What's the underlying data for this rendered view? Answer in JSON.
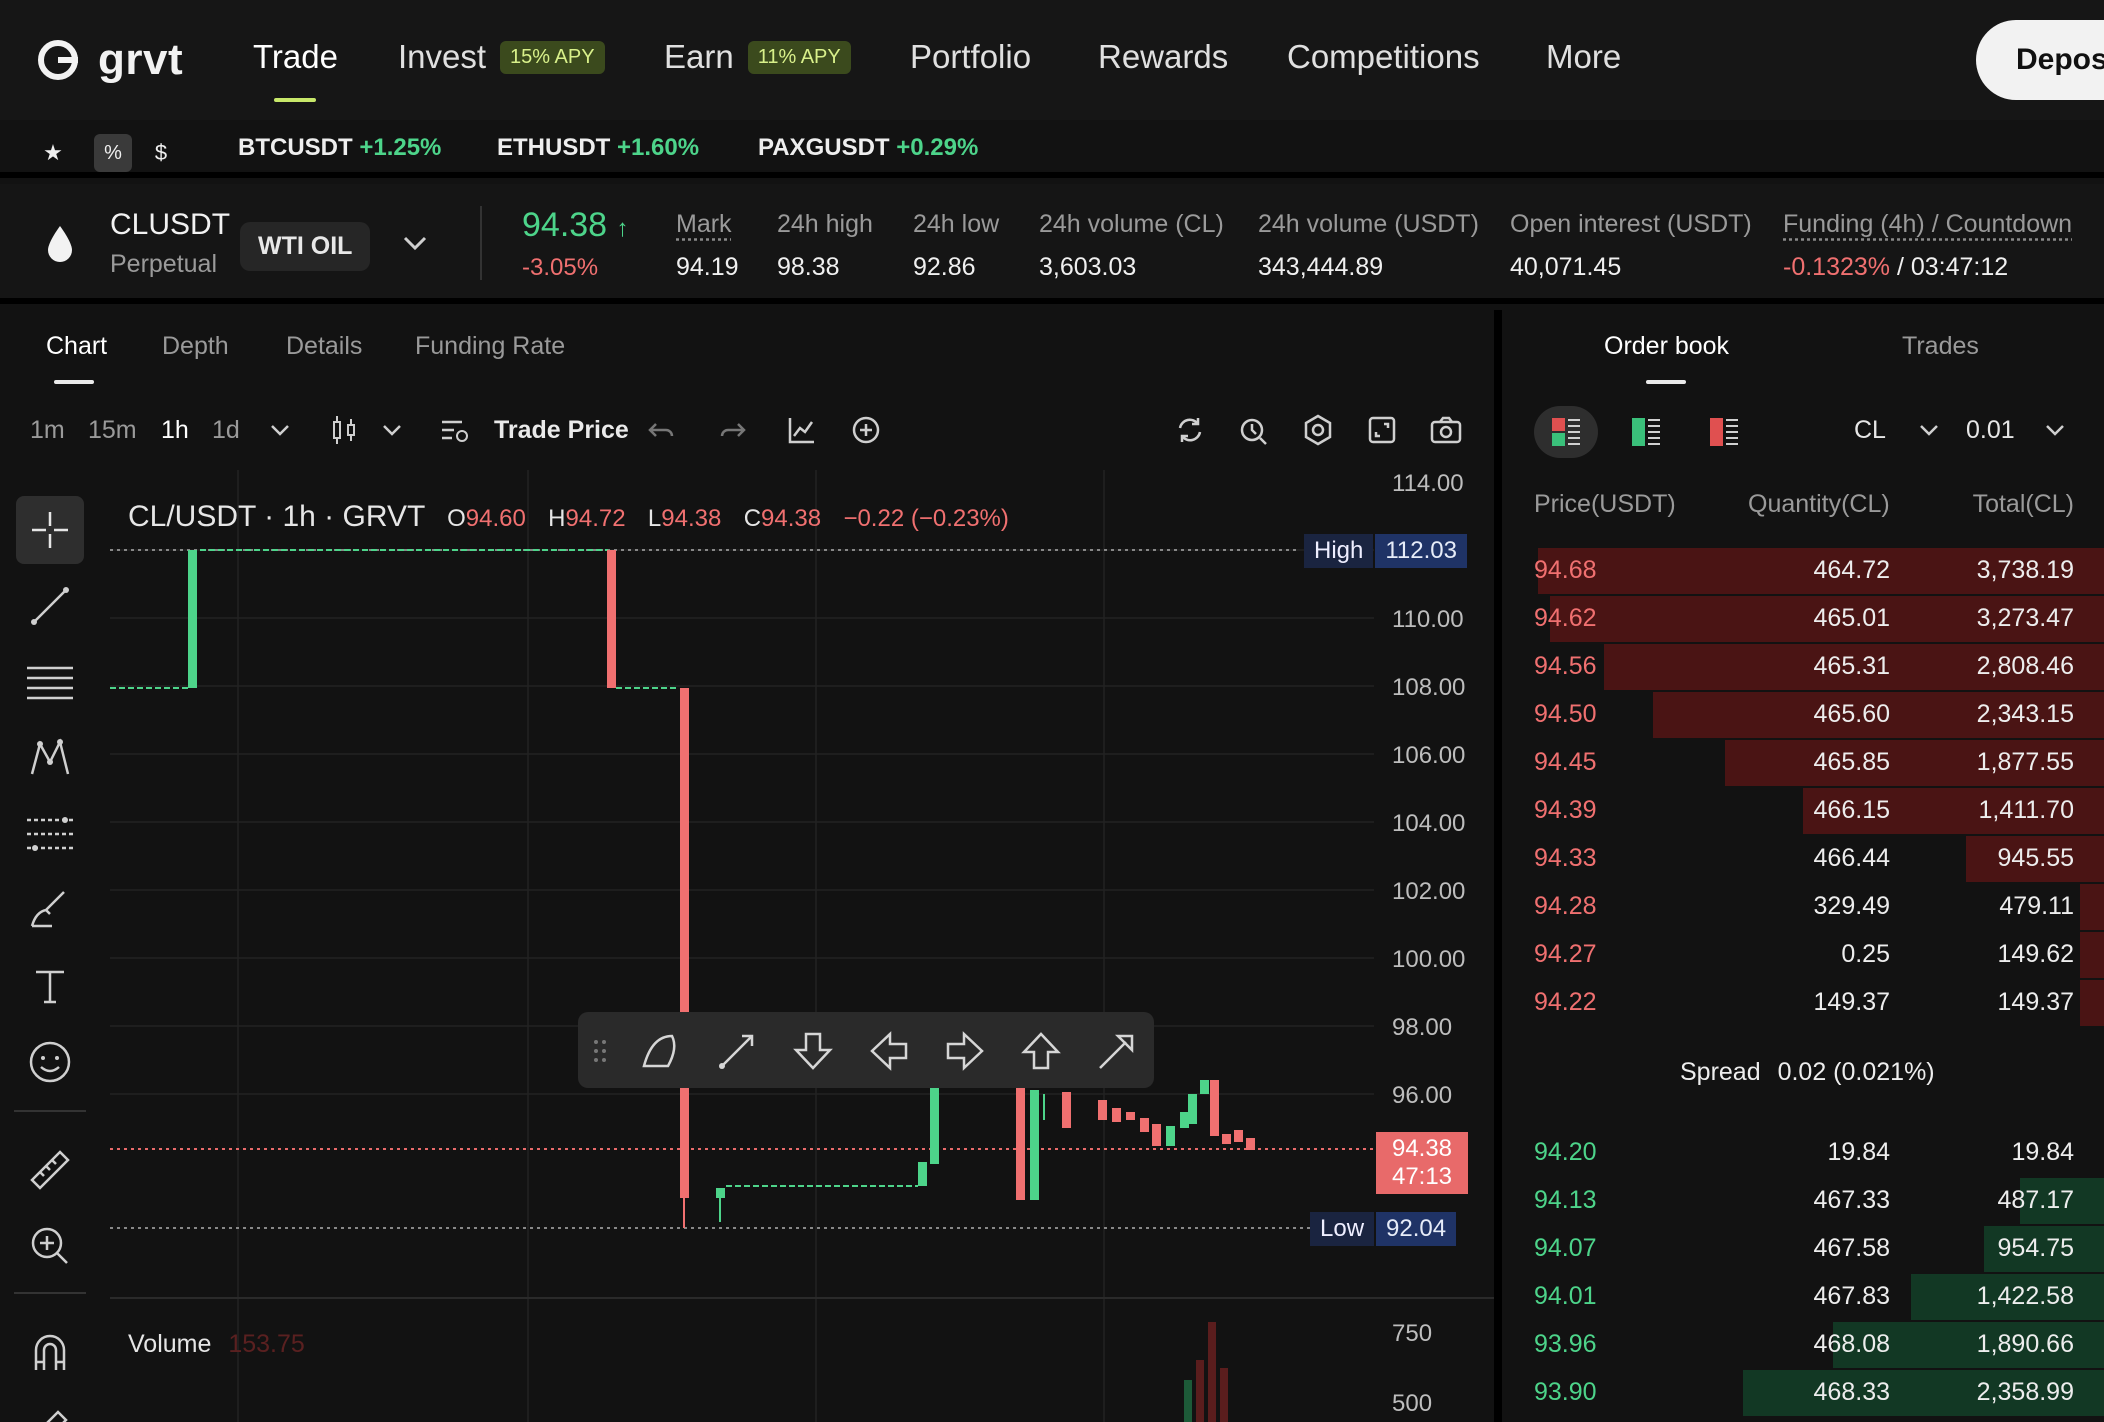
{
  "app": {
    "logo_text": "grvt",
    "nav": [
      {
        "label": "Trade"
      },
      {
        "label": "Invest",
        "badge": "15% APY"
      },
      {
        "label": "Earn",
        "badge": "11% APY"
      },
      {
        "label": "Portfolio"
      },
      {
        "label": "Rewards"
      },
      {
        "label": "Competitions"
      },
      {
        "label": "More"
      }
    ],
    "deposit_label": "Deposi"
  },
  "ticker": {
    "icons": {
      "star": "★",
      "percent": "%",
      "dollar": "$"
    },
    "items": [
      {
        "symbol": "BTCUSDT",
        "change": "+1.25%"
      },
      {
        "symbol": "ETHUSDT",
        "change": "+1.60%"
      },
      {
        "symbol": "PAXGUSDT",
        "change": "+0.29%"
      }
    ]
  },
  "instrument": {
    "symbol": "CLUSDT",
    "type": "Perpetual",
    "tag": "WTI OIL",
    "price": "94.38",
    "price_arrow": "↑",
    "change": "-3.05%",
    "stats": [
      {
        "label": "Mark",
        "value": "94.19"
      },
      {
        "label": "24h high",
        "value": "98.38"
      },
      {
        "label": "24h low",
        "value": "92.86"
      },
      {
        "label": "24h volume (CL)",
        "value": "3,603.03"
      },
      {
        "label": "24h volume (USDT)",
        "value": "343,444.89"
      },
      {
        "label": "Open interest (USDT)",
        "value": "40,071.45"
      }
    ],
    "funding": {
      "label": "Funding (4h) / Countdown",
      "rate": "-0.1323%",
      "sep": " / ",
      "countdown": "03:47:12"
    }
  },
  "chart_panel": {
    "tabs": [
      "Chart",
      "Depth",
      "Details",
      "Funding Rate"
    ],
    "timeframes": [
      "1m",
      "15m",
      "1h",
      "1d"
    ],
    "trade_price_label": "Trade Price",
    "legend": {
      "title": "CL/USDT · 1h · GRVT",
      "o_label": "O",
      "o": "94.60",
      "h_label": "H",
      "h": "94.72",
      "l_label": "L",
      "l": "94.38",
      "c_label": "C",
      "c": "94.38",
      "chg": "−0.22 (−0.23%)"
    },
    "axis": [
      "114.00",
      "110.00",
      "108.00",
      "106.00",
      "104.00",
      "102.00",
      "100.00",
      "98.00",
      "96.00"
    ],
    "high_tag": {
      "label": "High",
      "value": "112.03"
    },
    "low_tag": {
      "label": "Low",
      "value": "92.04"
    },
    "last_price_tag": {
      "price": "94.38",
      "countdown": "47:13"
    },
    "volume": {
      "label": "Volume",
      "value": "153.75",
      "axis": [
        "750",
        "500"
      ]
    },
    "colors": {
      "up": "#4dd48a",
      "down": "#f07070"
    }
  },
  "order_book": {
    "tabs": [
      "Order book",
      "Trades"
    ],
    "unit": "CL",
    "step": "0.01",
    "headers": {
      "price": "Price(USDT)",
      "qty": "Quantity(CL)",
      "total": "Total(CL)"
    },
    "asks": [
      {
        "price": "94.68",
        "qty": "464.72",
        "total": "3,738.19",
        "depth": 0.94
      },
      {
        "price": "94.62",
        "qty": "465.01",
        "total": "3,273.47",
        "depth": 0.92
      },
      {
        "price": "94.56",
        "qty": "465.31",
        "total": "2,808.46",
        "depth": 0.83
      },
      {
        "price": "94.50",
        "qty": "465.60",
        "total": "2,343.15",
        "depth": 0.75
      },
      {
        "price": "94.45",
        "qty": "465.85",
        "total": "1,877.55",
        "depth": 0.63
      },
      {
        "price": "94.39",
        "qty": "466.15",
        "total": "1,411.70",
        "depth": 0.5
      },
      {
        "price": "94.33",
        "qty": "466.44",
        "total": "945.55",
        "depth": 0.23
      },
      {
        "price": "94.28",
        "qty": "329.49",
        "total": "479.11",
        "depth": 0.04
      },
      {
        "price": "94.27",
        "qty": "0.25",
        "total": "149.62",
        "depth": 0.04
      },
      {
        "price": "94.22",
        "qty": "149.37",
        "total": "149.37",
        "depth": 0.04
      }
    ],
    "spread_label": "Spread",
    "spread_value": "0.02 (0.021%)",
    "bids": [
      {
        "price": "94.20",
        "qty": "19.84",
        "total": "19.84",
        "depth": 0.0
      },
      {
        "price": "94.13",
        "qty": "467.33",
        "total": "487.17",
        "depth": 0.14
      },
      {
        "price": "94.07",
        "qty": "467.58",
        "total": "954.75",
        "depth": 0.2
      },
      {
        "price": "94.01",
        "qty": "467.83",
        "total": "1,422.58",
        "depth": 0.32
      },
      {
        "price": "93.96",
        "qty": "468.08",
        "total": "1,890.66",
        "depth": 0.45
      },
      {
        "price": "93.90",
        "qty": "468.33",
        "total": "2,358.99",
        "depth": 0.6
      }
    ]
  }
}
